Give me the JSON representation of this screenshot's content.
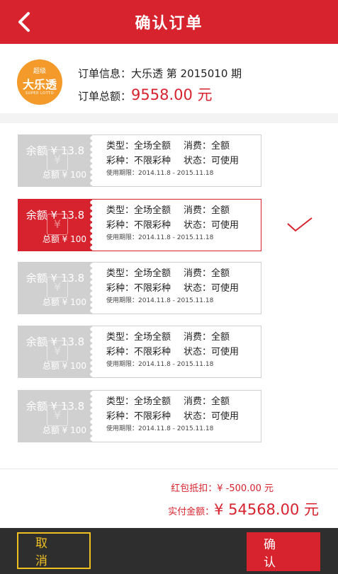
{
  "header": {
    "title": "确认订单"
  },
  "order": {
    "logo": {
      "top": "超级",
      "main": "大乐透",
      "sub": "SUPER LOTTO"
    },
    "info_label": "订单信息：",
    "info_value": "大乐透 第 2015010 期",
    "total_label": "订单总额：",
    "total_value": "9558.00 元"
  },
  "coupons": [
    {
      "balance": "余额 ¥ 13.8",
      "total": "总额 ¥ 100",
      "type": "类型：全场全额",
      "consume": "消费：全额",
      "kind": "彩种：不限彩种",
      "status": "状态：可使用",
      "validity": "使用期限：2014.11.8  -  2015.11.18",
      "selected": false
    },
    {
      "balance": "余额 ¥ 13.8",
      "total": "总额 ¥ 100",
      "type": "类型：全场全额",
      "consume": "消费：全额",
      "kind": "彩种：不限彩种",
      "status": "状态：可使用",
      "validity": "使用期限：2014.11.8  -  2015.11.18",
      "selected": true
    },
    {
      "balance": "余额 ¥ 13.8",
      "total": "总额 ¥ 100",
      "type": "类型：全场全额",
      "consume": "消费：全额",
      "kind": "彩种：不限彩种",
      "status": "状态：可使用",
      "validity": "使用期限：2014.11.8  -  2015.11.18",
      "selected": false
    },
    {
      "balance": "余额 ¥ 13.8",
      "total": "总额 ¥ 100",
      "type": "类型：全场全额",
      "consume": "消费：全额",
      "kind": "彩种：不限彩种",
      "status": "状态：可使用",
      "validity": "使用期限：2014.11.8  -  2015.11.18",
      "selected": false
    },
    {
      "balance": "余额 ¥ 13.8",
      "total": "总额 ¥ 100",
      "type": "类型：全场全额",
      "consume": "消费：全额",
      "kind": "彩种：不限彩种",
      "status": "状态：可使用",
      "validity": "使用期限：2014.11.8  -  2015.11.18",
      "selected": false
    }
  ],
  "summary": {
    "discount_label": "红包抵扣：",
    "discount_value": "¥ -500.00 元",
    "paid_label": "实付金额：",
    "paid_value": "¥ 54568.00 元"
  },
  "buttons": {
    "cancel": "取消",
    "confirm": "确认"
  },
  "icons": {
    "back": "chevron-left-icon",
    "check": "check-icon"
  },
  "colors": {
    "brand_red": "#d7232d",
    "cancel_yellow": "#f0c020",
    "footer_dark": "#2e2e2e",
    "stub_gray": "#d0d0d0",
    "logo_orange": "#f39a2a"
  }
}
